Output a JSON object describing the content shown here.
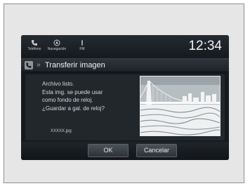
{
  "statusbar": {
    "items": [
      {
        "label": "Teléfono",
        "icon": "phone-icon"
      },
      {
        "label": "Navegación",
        "icon": "navigation-icon"
      },
      {
        "label": "FM",
        "icon": "radio-icon"
      }
    ],
    "clock": "12:34"
  },
  "titlebar": {
    "icon": "phone-icon",
    "chevron": "»",
    "title": "Transferir imagen"
  },
  "dialog": {
    "message": "Archivo listo.\nEsta img. se puede usar\ncomo fondo de reloj.\n¿Guardar a gal. de reloj?",
    "filename": "XXXXX.jpg",
    "thumbnail_icon": "bridge-image"
  },
  "buttons": {
    "ok": "OK",
    "cancel": "Cancelar"
  }
}
